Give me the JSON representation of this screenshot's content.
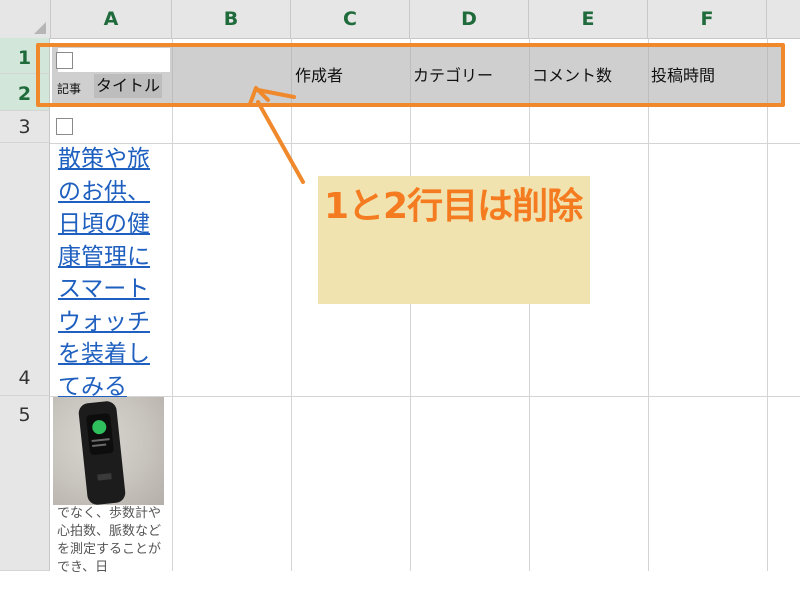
{
  "spreadsheet": {
    "columns": [
      "A",
      "B",
      "C",
      "D",
      "E",
      "F"
    ],
    "rows": [
      "1",
      "2",
      "3",
      "4",
      "5"
    ],
    "header_labels": {
      "kiji": "記事",
      "title": "タイトル",
      "author": "作成者",
      "category": "カテゴリー",
      "comments": "コメント数",
      "posted_time": "投稿時間"
    },
    "a4_link": "散策や旅のお供、日頃の健康管理にスマートウォッチを装着してみる",
    "a5_description": "でなく、歩数計や心拍数、脈数などを測定することができ、日",
    "photo": "smartwatch-photo"
  },
  "annotation": {
    "note": "1と2行目は削除",
    "highlight_color": "#f0882c",
    "note_background": "#f1e3af"
  }
}
